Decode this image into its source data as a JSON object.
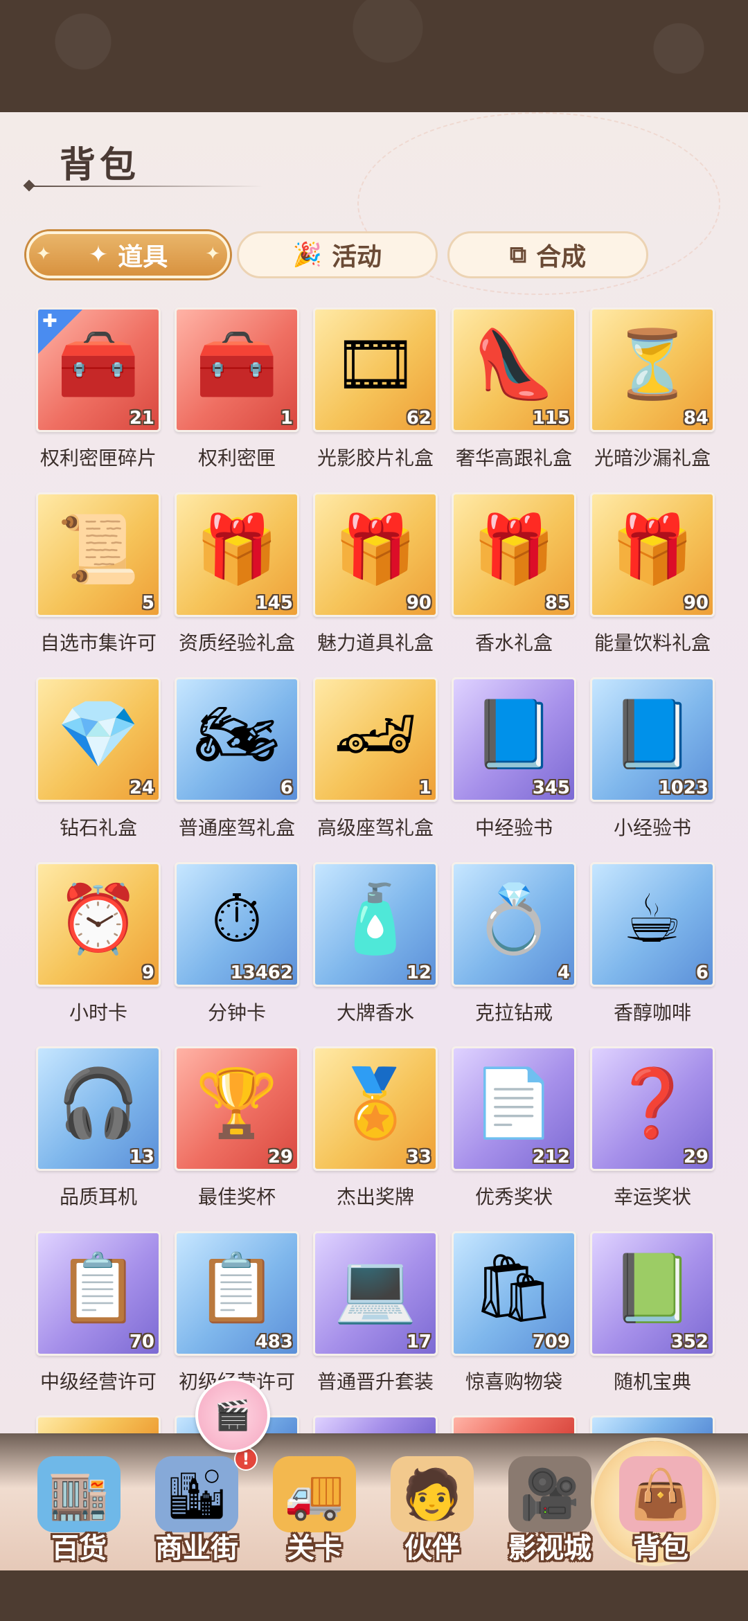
{
  "header": {
    "title": "背包"
  },
  "tabs": [
    {
      "label": "道具",
      "icon": "magic-wand-icon",
      "active": true
    },
    {
      "label": "活动",
      "icon": "party-popper-icon",
      "active": false
    },
    {
      "label": "合成",
      "icon": "combine-icon",
      "active": false
    }
  ],
  "items": [
    {
      "name": "权利密匣碎片",
      "count": "21",
      "icon": "treasure-chest-fragment-icon",
      "bg": "red",
      "fragment": true
    },
    {
      "name": "权利密匣",
      "count": "1",
      "icon": "treasure-chest-icon",
      "bg": "red"
    },
    {
      "name": "光影胶片礼盒",
      "count": "62",
      "icon": "film-reel-gift-icon",
      "bg": "gold"
    },
    {
      "name": "奢华高跟礼盒",
      "count": "115",
      "icon": "high-heel-gift-icon",
      "bg": "gold"
    },
    {
      "name": "光暗沙漏礼盒",
      "count": "84",
      "icon": "hourglass-gift-icon",
      "bg": "gold"
    },
    {
      "name": "自选市集许可",
      "count": "5",
      "icon": "certificate-icon",
      "bg": "gold"
    },
    {
      "name": "资质经验礼盒",
      "count": "145",
      "icon": "gift-box-icon",
      "bg": "gold"
    },
    {
      "name": "魅力道具礼盒",
      "count": "90",
      "icon": "gift-box-icon",
      "bg": "gold"
    },
    {
      "name": "香水礼盒",
      "count": "85",
      "icon": "gift-box-icon",
      "bg": "gold"
    },
    {
      "name": "能量饮料礼盒",
      "count": "90",
      "icon": "gift-box-icon",
      "bg": "gold"
    },
    {
      "name": "钻石礼盒",
      "count": "24",
      "icon": "diamond-gift-icon",
      "bg": "gold"
    },
    {
      "name": "普通座驾礼盒",
      "count": "6",
      "icon": "motorcycle-icon",
      "bg": "blue"
    },
    {
      "name": "高级座驾礼盒",
      "count": "1",
      "icon": "race-car-icon",
      "bg": "gold"
    },
    {
      "name": "中经验书",
      "count": "345",
      "icon": "book-icon",
      "bg": "purple"
    },
    {
      "name": "小经验书",
      "count": "1023",
      "icon": "book-icon",
      "bg": "blue"
    },
    {
      "name": "小时卡",
      "count": "9",
      "icon": "hour-card-icon",
      "bg": "gold"
    },
    {
      "name": "分钟卡",
      "count": "13462",
      "icon": "minute-card-icon",
      "bg": "blue"
    },
    {
      "name": "大牌香水",
      "count": "12",
      "icon": "perfume-icon",
      "bg": "blue"
    },
    {
      "name": "克拉钻戒",
      "count": "4",
      "icon": "ring-icon",
      "bg": "blue"
    },
    {
      "name": "香醇咖啡",
      "count": "6",
      "icon": "coffee-icon",
      "bg": "blue"
    },
    {
      "name": "品质耳机",
      "count": "13",
      "icon": "headphones-icon",
      "bg": "blue"
    },
    {
      "name": "最佳奖杯",
      "count": "29",
      "icon": "trophy-icon",
      "bg": "red"
    },
    {
      "name": "杰出奖牌",
      "count": "33",
      "icon": "medal-icon",
      "bg": "gold"
    },
    {
      "name": "优秀奖状",
      "count": "212",
      "icon": "award-certificate-icon",
      "bg": "purple"
    },
    {
      "name": "幸运奖状",
      "count": "29",
      "icon": "mystery-card-icon",
      "bg": "purple"
    },
    {
      "name": "中级经营许可",
      "count": "70",
      "icon": "clipboard-icon",
      "bg": "purple"
    },
    {
      "name": "初级经营许可",
      "count": "483",
      "icon": "clipboard-icon",
      "bg": "blue"
    },
    {
      "name": "普通晋升套装",
      "count": "17",
      "icon": "computer-kit-icon",
      "bg": "purple"
    },
    {
      "name": "惊喜购物袋",
      "count": "709",
      "icon": "shopping-bag-icon",
      "bg": "blue"
    },
    {
      "name": "随机宝典",
      "count": "352",
      "icon": "mystery-book-icon",
      "bg": "purple"
    }
  ],
  "peek_row": [
    "gold",
    "blue",
    "purple",
    "red",
    "blue"
  ],
  "bottom_nav": [
    {
      "label": "百货",
      "icon": "department-store-icon",
      "active": false
    },
    {
      "label": "商业街",
      "icon": "business-street-icon",
      "active": false,
      "alert": "!"
    },
    {
      "label": "关卡",
      "icon": "truck-icon",
      "active": false
    },
    {
      "label": "伙伴",
      "icon": "partner-icon",
      "active": false
    },
    {
      "label": "影视城",
      "icon": "film-camera-icon",
      "active": false
    },
    {
      "label": "背包",
      "icon": "handbag-icon",
      "active": true
    }
  ],
  "glyphs": {
    "treasure-chest-fragment-icon": "🧰",
    "treasure-chest-icon": "🧰",
    "film-reel-gift-icon": "🎞",
    "high-heel-gift-icon": "👠",
    "hourglass-gift-icon": "⏳",
    "certificate-icon": "📜",
    "gift-box-icon": "🎁",
    "diamond-gift-icon": "💎",
    "motorcycle-icon": "🏍",
    "race-car-icon": "🏎",
    "book-icon": "📘",
    "hour-card-icon": "⏰",
    "minute-card-icon": "⏱",
    "perfume-icon": "🧴",
    "ring-icon": "💍",
    "coffee-icon": "☕",
    "headphones-icon": "🎧",
    "trophy-icon": "🏆",
    "medal-icon": "🏅",
    "award-certificate-icon": "📄",
    "mystery-card-icon": "❓",
    "clipboard-icon": "📋",
    "computer-kit-icon": "💻",
    "shopping-bag-icon": "🛍",
    "mystery-book-icon": "📗",
    "department-store-icon": "🏬",
    "business-street-icon": "🏙",
    "truck-icon": "🚚",
    "partner-icon": "🧑",
    "film-camera-icon": "🎥",
    "handbag-icon": "👜",
    "magic-wand-icon": "✦",
    "party-popper-icon": "🎉",
    "combine-icon": "⧉"
  }
}
